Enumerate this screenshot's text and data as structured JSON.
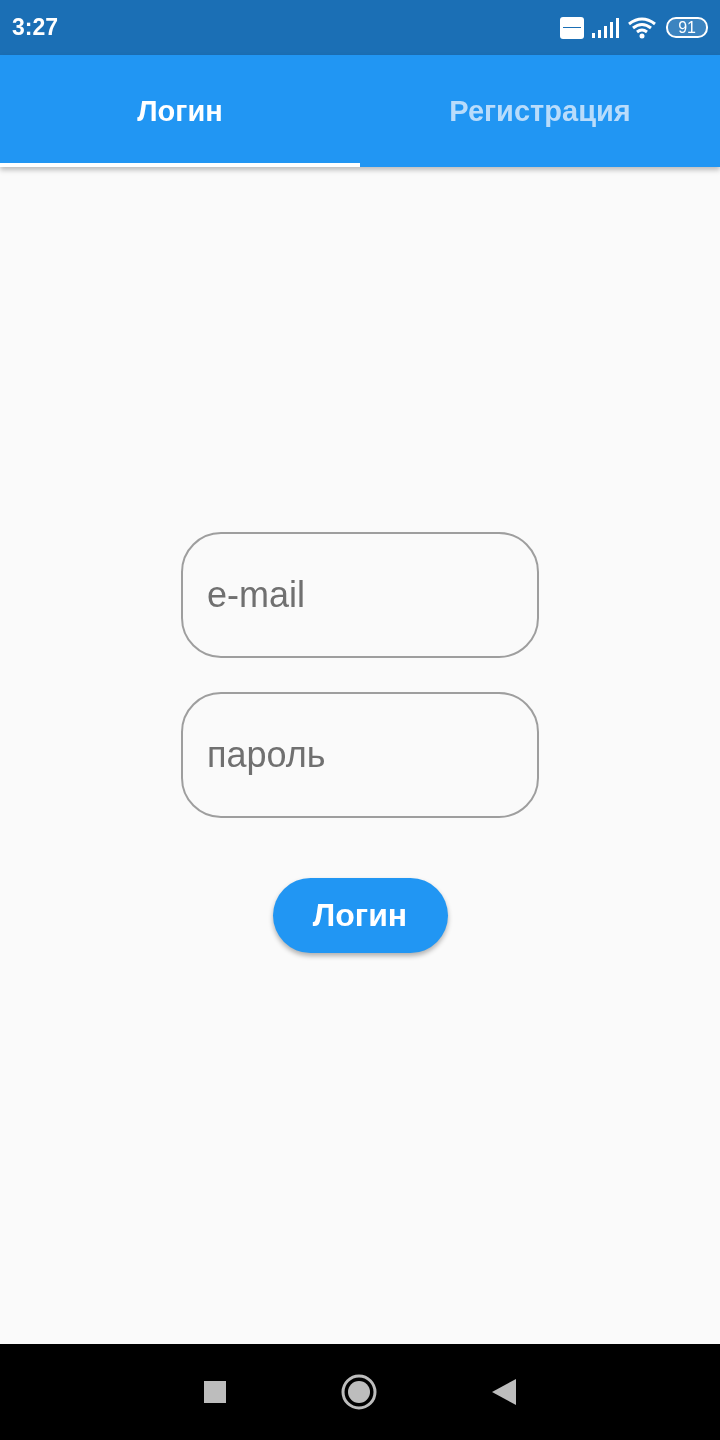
{
  "status_bar": {
    "time": "3:27",
    "battery": "91"
  },
  "tabs": [
    {
      "label": "Логин",
      "selected": true
    },
    {
      "label": "Регистрация",
      "selected": false
    }
  ],
  "form": {
    "fields": [
      {
        "placeholder": "e-mail"
      },
      {
        "placeholder": "пароль"
      }
    ],
    "button": "Логин"
  }
}
